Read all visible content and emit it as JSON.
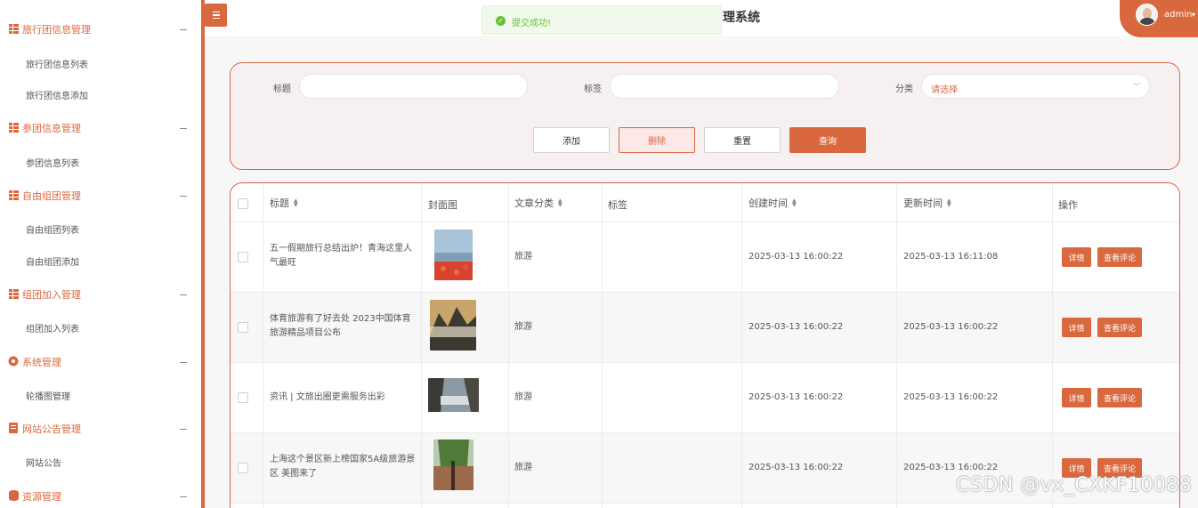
{
  "sidebar": {
    "groups": [
      {
        "label": "旅行团信息管理",
        "items": [
          "旅行团信息列表",
          "旅行团信息添加"
        ]
      },
      {
        "label": "参团信息管理",
        "items": [
          "参团信息列表"
        ]
      },
      {
        "label": "自由组团管理",
        "items": [
          "自由组团列表",
          "自由组团添加"
        ]
      },
      {
        "label": "组团加入管理",
        "items": [
          "组团加入列表"
        ]
      },
      {
        "label": "系统管理",
        "items": [
          "轮播图管理"
        ]
      },
      {
        "label": "网站公告管理",
        "items": [
          "网站公告"
        ]
      },
      {
        "label": "资源管理",
        "items": []
      }
    ]
  },
  "header": {
    "title_fragment": "理系统",
    "toast": "提交成功!",
    "user": "admin"
  },
  "search": {
    "title_label": "标题",
    "tag_label": "标签",
    "category_label": "分类",
    "category_placeholder": "请选择",
    "buttons": {
      "add": "添加",
      "delete": "删除",
      "reset": "重置",
      "query": "查询"
    }
  },
  "table": {
    "headers": {
      "title": "标题",
      "cover": "封面图",
      "category": "文章分类",
      "tags": "标签",
      "created": "创建时间",
      "updated": "更新时间",
      "actions": "操作"
    },
    "rows": [
      {
        "title": "五一假期旅行总结出炉！青海这里人气最旺",
        "category": "旅游",
        "tags": "",
        "created": "2025-03-13 16:00:22",
        "updated": "2025-03-13 16:11:08",
        "detail": "详情",
        "comments": "查看评论"
      },
      {
        "title": "体育旅游有了好去处 2023中国体育旅游精品项目公布",
        "category": "旅游",
        "tags": "",
        "created": "2025-03-13 16:00:22",
        "updated": "2025-03-13 16:00:22",
        "detail": "详情",
        "comments": "查看评论"
      },
      {
        "title": "资讯 | 文旅出圈更需服务出彩",
        "category": "旅游",
        "tags": "",
        "created": "2025-03-13 16:00:22",
        "updated": "2025-03-13 16:00:22",
        "detail": "详情",
        "comments": "查看评论"
      },
      {
        "title": "上海这个景区新上榜国家5A级旅游景区 美图来了",
        "category": "旅游",
        "tags": "",
        "created": "2025-03-13 16:00:22",
        "updated": "2025-03-13 16:00:22",
        "detail": "详情",
        "comments": "查看评论"
      }
    ]
  },
  "watermark": "CSDN @vx_CXKF10088",
  "colors": {
    "accent": "#d9683f",
    "success": "#67c23a"
  }
}
